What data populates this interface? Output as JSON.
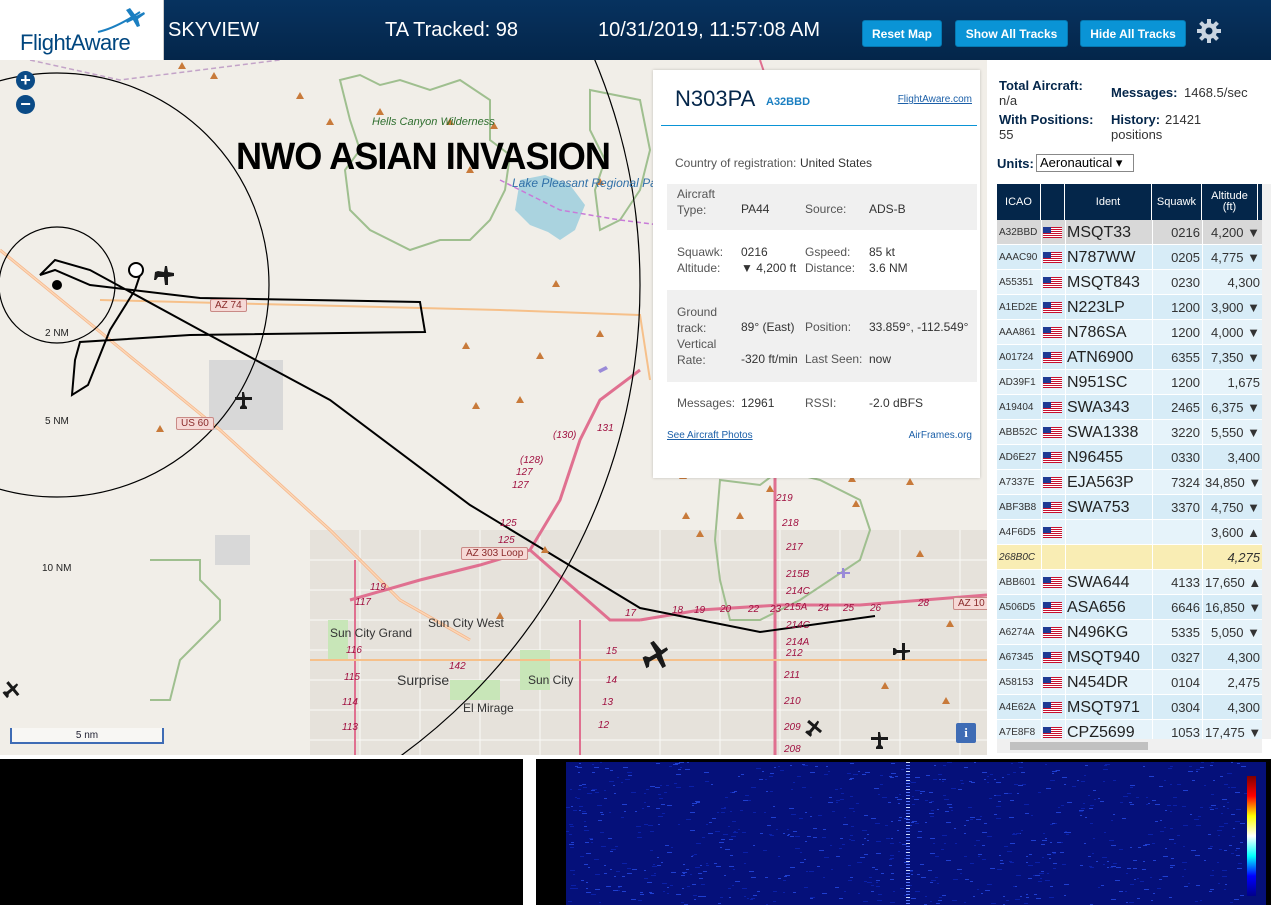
{
  "header": {
    "logo_text": "FlightAware",
    "app_name": "SKYVIEW",
    "tracked_label": "TA Tracked: 98",
    "datetime": "10/31/2019, 11:57:08 AM",
    "buttons": {
      "reset_map": "Reset Map",
      "show_all": "Show All Tracks",
      "hide_all": "Hide All Tracks"
    }
  },
  "map": {
    "zoom_in": "+",
    "zoom_out": "−",
    "overlay_text": "NWO ASIAN INVASION",
    "rings": [
      "2 NM",
      "5 NM",
      "10 NM"
    ],
    "scale": "5 nm",
    "info_button": "i",
    "labels": {
      "hells_canyon": "Hells Canyon Wilderness",
      "lake_pleasant": "Lake Pleasant Regional Park",
      "sun_city_grand": "Sun City Grand",
      "sun_city_west": "Sun City West",
      "surprise": "Surprise",
      "sun_city": "Sun City",
      "el_mirage": "El Mirage"
    },
    "shields": {
      "az74": "AZ 74",
      "us60": "US 60",
      "az303": "AZ 303 Loop",
      "az101": "AZ 10"
    },
    "road_numbers": {
      "r130": "(130)",
      "r131": "131",
      "r128": "(128)",
      "r127a": "127",
      "r127b": "127",
      "r125a": "125",
      "r125b": "125",
      "r119": "119",
      "r117": "117",
      "r142": "142",
      "r116": "116",
      "r115": "115",
      "r114": "114",
      "r113": "113",
      "r219": "219",
      "r218": "218",
      "r217": "217",
      "r215b": "215B",
      "r214c": "214C",
      "r215a": "215A",
      "r214c2": "214C",
      "r214a": "214A",
      "r212": "212",
      "r211": "211",
      "r210": "210",
      "r209": "209",
      "r208": "208",
      "r17": "17",
      "r18": "18",
      "r19": "19",
      "r20": "20",
      "r22": "22",
      "r23": "23",
      "r24": "24",
      "r25": "25",
      "r26": "26",
      "r28": "28",
      "r15": "15",
      "r14": "14",
      "r13": "13",
      "r12": "12"
    }
  },
  "selected": {
    "callsign": "N303PA",
    "hex": "A32BBD",
    "fa_link": "FlightAware.com",
    "country_label": "Country of registration:",
    "country": "United States",
    "aircraft_type_label": "Aircraft Type:",
    "aircraft_type": "PA44",
    "source_label": "Source:",
    "source": "ADS-B",
    "squawk_label": "Squawk:",
    "squawk": "0216",
    "altitude_label": "Altitude:",
    "altitude": "▼ 4,200 ft",
    "gspeed_label": "Gspeed:",
    "gspeed": "85 kt",
    "distance_label": "Distance:",
    "distance": "3.6 NM",
    "ground_track_label": "Ground track:",
    "ground_track": "89° (East)",
    "position_label": "Position:",
    "position": "33.859°, -112.549°",
    "vrate_label": "Vertical Rate:",
    "vrate": "-320 ft/min",
    "last_seen_label": "Last Seen:",
    "last_seen": "now",
    "messages_label": "Messages:",
    "messages": "12961",
    "rssi_label": "RSSI:",
    "rssi": "-2.0 dBFS",
    "photos_link": "See Aircraft Photos",
    "airframes_link": "AirFrames.org"
  },
  "stats": {
    "total_label": "Total Aircraft:",
    "total": "n/a",
    "messages_label": "Messages:",
    "messages": "1468.5/sec",
    "with_pos_label": "With Positions:",
    "with_pos": "55",
    "history_label": "History:",
    "history": "21421 positions",
    "units_label": "Units:",
    "units": "Aeronautical ▾"
  },
  "table": {
    "headers": [
      "ICAO",
      "",
      "Ident",
      "Squawk",
      "Altitude (ft)"
    ],
    "rows": [
      {
        "icao": "A32BBD",
        "ident": "MSQT33",
        "squawk": "0216",
        "alt": "4,200 ▼"
      },
      {
        "icao": "AAAC90",
        "ident": "N787WW",
        "squawk": "0205",
        "alt": "4,775 ▼"
      },
      {
        "icao": "A55351",
        "ident": "MSQT843",
        "squawk": "0230",
        "alt": "4,300"
      },
      {
        "icao": "A1ED2E",
        "ident": "N223LP",
        "squawk": "1200",
        "alt": "3,900 ▼"
      },
      {
        "icao": "AAA861",
        "ident": "N786SA",
        "squawk": "1200",
        "alt": "4,000 ▼"
      },
      {
        "icao": "A01724",
        "ident": "ATN6900",
        "squawk": "6355",
        "alt": "7,350 ▼"
      },
      {
        "icao": "AD39F1",
        "ident": "N951SC",
        "squawk": "1200",
        "alt": "1,675"
      },
      {
        "icao": "A19404",
        "ident": "SWA343",
        "squawk": "2465",
        "alt": "6,375 ▼"
      },
      {
        "icao": "ABB52C",
        "ident": "SWA1338",
        "squawk": "3220",
        "alt": "5,550 ▼"
      },
      {
        "icao": "AD6E27",
        "ident": "N96455",
        "squawk": "0330",
        "alt": "3,400"
      },
      {
        "icao": "A7337E",
        "ident": "EJA563P",
        "squawk": "7324",
        "alt": "34,850 ▼"
      },
      {
        "icao": "ABF3B8",
        "ident": "SWA753",
        "squawk": "3370",
        "alt": "4,750 ▼"
      },
      {
        "icao": "A4F6D5",
        "ident": "",
        "squawk": "",
        "alt": "3,600 ▲"
      },
      {
        "icao": "268B0C",
        "ident": "",
        "squawk": "",
        "alt": "4,275"
      },
      {
        "icao": "ABB601",
        "ident": "SWA644",
        "squawk": "4133",
        "alt": "17,650 ▲"
      },
      {
        "icao": "A506D5",
        "ident": "ASA656",
        "squawk": "6646",
        "alt": "16,850 ▼"
      },
      {
        "icao": "A6274A",
        "ident": "N496KG",
        "squawk": "5335",
        "alt": "5,050 ▼"
      },
      {
        "icao": "A67345",
        "ident": "MSQT940",
        "squawk": "0327",
        "alt": "4,300"
      },
      {
        "icao": "A58153",
        "ident": "N454DR",
        "squawk": "0104",
        "alt": "2,475"
      },
      {
        "icao": "A4E62A",
        "ident": "MSQT971",
        "squawk": "0304",
        "alt": "4,300"
      },
      {
        "icao": "A7E8F8",
        "ident": "CPZ5699",
        "squawk": "1053",
        "alt": "17,475 ▼"
      }
    ]
  },
  "colors": {
    "header_bg": "#04264a",
    "button_bg": "#0a94d6",
    "row_selected": "#d8d8d8",
    "row_blue": "#d7ecf7",
    "row_warn": "#f9edb4"
  }
}
